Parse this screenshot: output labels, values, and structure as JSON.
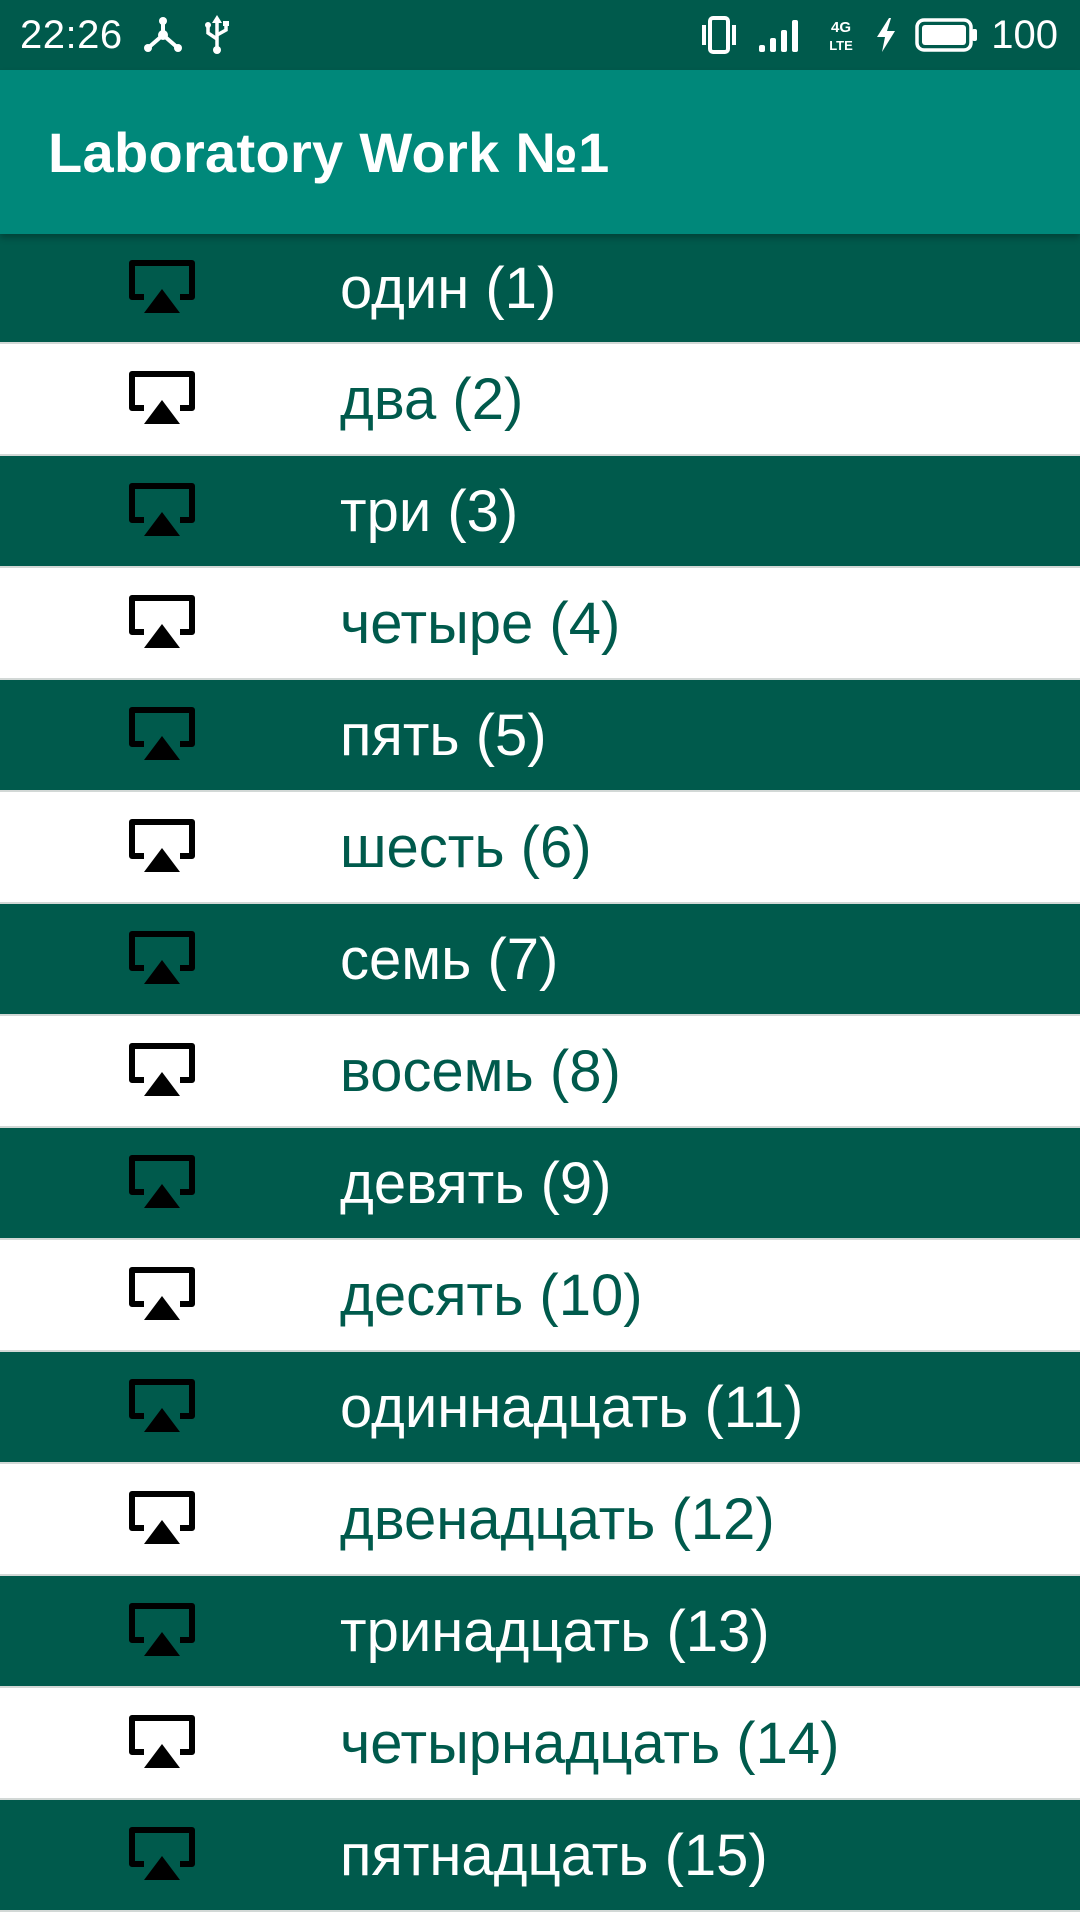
{
  "status_bar": {
    "time": "22:26",
    "left_icons": [
      "hub-icon",
      "usb-icon"
    ],
    "right_icons": [
      "vibrate-icon",
      "signal-icon",
      "4g-lte-icon",
      "charging-icon",
      "battery-icon"
    ],
    "network_top": "4G",
    "network_bottom": "LTE",
    "battery_level": "100"
  },
  "app_bar": {
    "title": "Laboratory Work №1"
  },
  "colors": {
    "status_bar": "#005a4c",
    "app_bar": "#00887a",
    "row_dark": "#005a4c",
    "row_light": "#ffffff",
    "text_on_light": "#005a4c"
  },
  "list": {
    "row_icon": "airplay-icon",
    "items": [
      "один (1)",
      "два (2)",
      "три (3)",
      "четыре (4)",
      "пять (5)",
      "шесть (6)",
      "семь (7)",
      "восемь (8)",
      "девять (9)",
      "десять (10)",
      "одиннадцать (11)",
      "двенадцать (12)",
      "тринадцать (13)",
      "четырнадцать (14)",
      "пятнадцать (15)"
    ]
  }
}
